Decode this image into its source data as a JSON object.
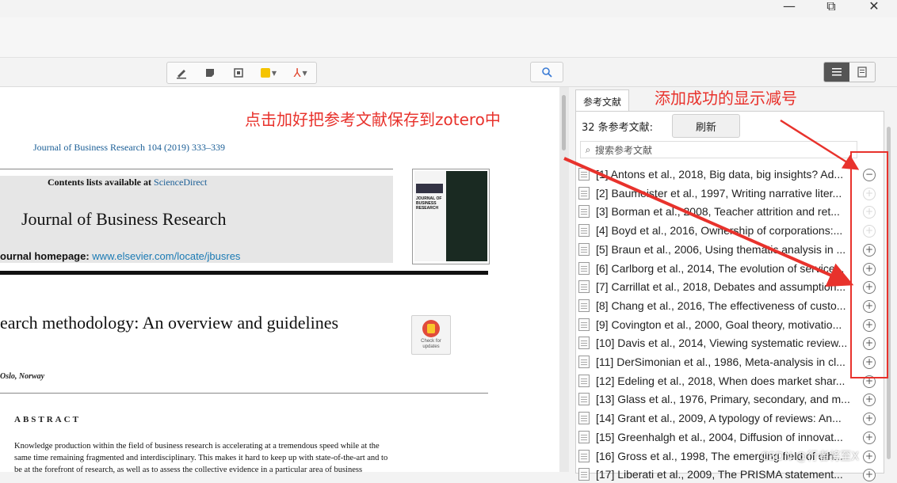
{
  "window": {
    "minimize": "—",
    "restore": "⧉",
    "close": "✕"
  },
  "toolbar": {
    "tools": [
      {
        "name": "highlight-pen-icon",
        "glyph": "✎"
      },
      {
        "name": "note-icon",
        "glyph": "▪"
      },
      {
        "name": "add-note-icon",
        "glyph": "▣"
      },
      {
        "name": "color-picker",
        "glyph": "■"
      },
      {
        "name": "pdf-icon",
        "glyph": "⅄"
      }
    ],
    "search_glyph": "🔍"
  },
  "pdf": {
    "journal_ref": "Journal of Business Research 104 (2019) 333–339",
    "contents_prefix": "Contents lists available at ",
    "contents_link": "ScienceDirect",
    "journal_name": "Journal of Business Research",
    "homepage_prefix": "ournal homepage: ",
    "homepage_url": "www.elsevier.com/locate/jbusres",
    "cover_title": "JOURNAL OF BUSINESS RESEARCH",
    "article_title": "earch methodology: An overview and guidelines",
    "badge_text": "Check for updates",
    "affiliation": "Oslo, Norway",
    "abstract_heading": "ABSTRACT",
    "abstract_lines": [
      "Knowledge production within the field of business research is accelerating at a tremendous speed while at the",
      "same time remaining fragmented and interdisciplinary. This makes it hard to keep up with state-of-the-art and to",
      "be at the forefront of research, as well as to assess the collective evidence in a particular area of business"
    ]
  },
  "annotations": {
    "left": "点击加好把参考文献保存到zotero中",
    "right": "添加成功的显示减号"
  },
  "panel": {
    "tab": "参考文献",
    "count": "32 条参考文献:",
    "refresh": "刷新",
    "search_placeholder": "搜索参考文献",
    "references": [
      {
        "text": "[1] Antons et al., 2018, Big data, big insights? Ad...",
        "state": "minus"
      },
      {
        "text": "[2] Baumeister et al., 1997, Writing narrative liter...",
        "state": "faint"
      },
      {
        "text": "[3] Borman et al., 2008, Teacher attrition and ret...",
        "state": "faint"
      },
      {
        "text": "[4] Boyd et al., 2016, Ownership of corporations:...",
        "state": "faint"
      },
      {
        "text": "[5] Braun et al., 2006, Using thematic analysis in ...",
        "state": "plus"
      },
      {
        "text": "[6] Carlborg et al., 2014, The evolution of service...",
        "state": "plus"
      },
      {
        "text": "[7] Carrillat et al., 2018, Debates and assumption...",
        "state": "plus"
      },
      {
        "text": "[8] Chang et al., 2016, The effectiveness of custo...",
        "state": "plus"
      },
      {
        "text": "[9] Covington et al., 2000, Goal theory, motivatio...",
        "state": "plus"
      },
      {
        "text": "[10] Davis et al., 2014, Viewing systematic review...",
        "state": "plus"
      },
      {
        "text": "[11] DerSimonian et al., 1986, Meta-analysis in cl...",
        "state": "plus"
      },
      {
        "text": "[12] Edeling et al., 2018, When does market shar...",
        "state": "plus"
      },
      {
        "text": "[13] Glass et al., 1976, Primary, secondary, and m...",
        "state": "plus"
      },
      {
        "text": "[14] Grant et al., 2009, A typology of reviews: An...",
        "state": "plus"
      },
      {
        "text": "[15] Greenhalgh et al., 2004, Diffusion of innovat...",
        "state": "plus"
      },
      {
        "text": "[16] Gross et al., 1998, The emerging field of eth...",
        "state": "plus"
      },
      {
        "text": "[17] Liberati et al., 2009, The PRISMA statement...",
        "state": "plus"
      }
    ]
  },
  "watermark": "CSDN @行者将至X",
  "colors": {
    "annotation": "#e8322c",
    "link": "#1a5e96",
    "highlight_yellow": "#f5c400",
    "pdf_red": "#e0442c"
  }
}
